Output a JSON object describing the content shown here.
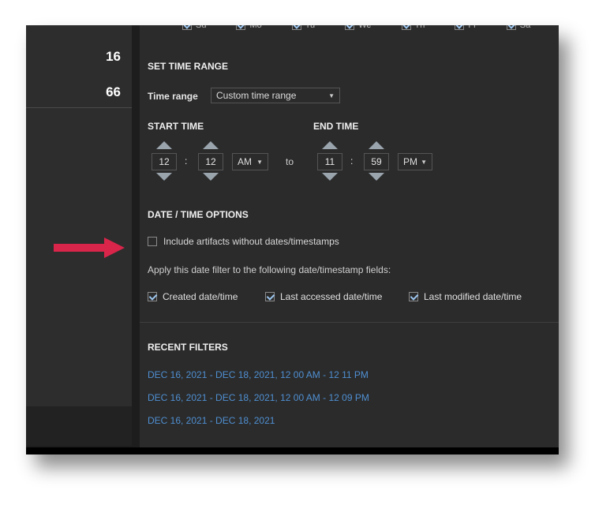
{
  "left_pane": {
    "counts": [
      "16",
      "66"
    ]
  },
  "days": [
    {
      "label": "Su",
      "checked": true
    },
    {
      "label": "Mo",
      "checked": true
    },
    {
      "label": "Tu",
      "checked": true
    },
    {
      "label": "We",
      "checked": true
    },
    {
      "label": "Th",
      "checked": true
    },
    {
      "label": "Fr",
      "checked": true
    },
    {
      "label": "Sa",
      "checked": true
    }
  ],
  "time_range": {
    "heading": "SET TIME RANGE",
    "label": "Time range",
    "value": "Custom time range"
  },
  "start_time": {
    "heading": "START TIME",
    "hour": "12",
    "minute": "12",
    "ampm": "AM"
  },
  "to_label": "to",
  "end_time": {
    "heading": "END TIME",
    "hour": "11",
    "minute": "59",
    "ampm": "PM"
  },
  "options": {
    "heading": "DATE / TIME OPTIONS",
    "include_label": "Include artifacts without dates/timestamps",
    "include_checked": false,
    "apply_text": "Apply this date filter to the following date/timestamp fields:",
    "fields": [
      {
        "label": "Created date/time",
        "checked": true
      },
      {
        "label": "Last accessed date/time",
        "checked": true
      },
      {
        "label": "Last modified date/time",
        "checked": true
      }
    ]
  },
  "recent": {
    "heading": "RECENT FILTERS",
    "items": [
      "DEC 16, 2021 - DEC 18, 2021, 12 00 AM - 12 11 PM",
      "DEC 16, 2021 - DEC 18, 2021, 12 00 AM - 12 09 PM",
      "DEC 16, 2021 - DEC 18, 2021"
    ]
  },
  "colors": {
    "arrow": "#d9254a",
    "link": "#4f8fd1",
    "panel": "#2b2b2b"
  }
}
